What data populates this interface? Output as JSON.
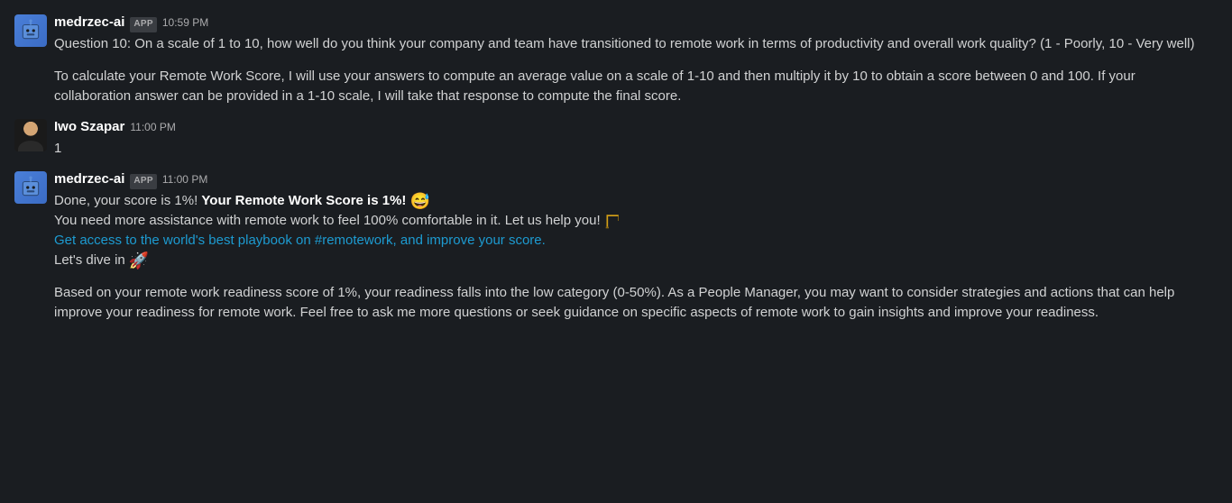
{
  "messages": [
    {
      "sender": "medrzec-ai",
      "app_badge": "APP",
      "timestamp": "10:59 PM",
      "p1": "Question 10: On a scale of 1 to 10, how well do you think your company and team have transitioned to remote work in terms of productivity and overall work quality? (1 - Poorly, 10 - Very well)",
      "p2": "To calculate your Remote Work Score, I will use your answers to compute an average value on a scale of 1-10 and then multiply it by 10 to obtain a score between 0 and 100. If your collaboration answer can be provided in a 1-10 scale, I will take that response to compute the final score."
    },
    {
      "sender": "Iwo Szapar",
      "timestamp": "11:00 PM",
      "body": "1"
    },
    {
      "sender": "medrzec-ai",
      "app_badge": "APP",
      "timestamp": "11:00 PM",
      "l1_plain": "Done, your score is 1%! ",
      "l1_bold": "Your Remote Work Score is 1%!",
      "l1_emoji": "😅",
      "l2": "You need more assistance with remote work to feel 100% comfortable in it. Let us help you! ",
      "l3_link": "Get access to the world's best playbook on #remotework, and improve your score.",
      "l4": "Let's dive in ",
      "l4_emoji": "🚀",
      "p2": "Based on your remote work readiness score of 1%, your readiness falls into the low category (0-50%). As a People Manager, you may want to consider strategies and actions that can help improve your readiness for remote work. Feel free to ask me more questions or seek guidance on specific aspects of remote work to gain insights and improve your readiness."
    }
  ]
}
